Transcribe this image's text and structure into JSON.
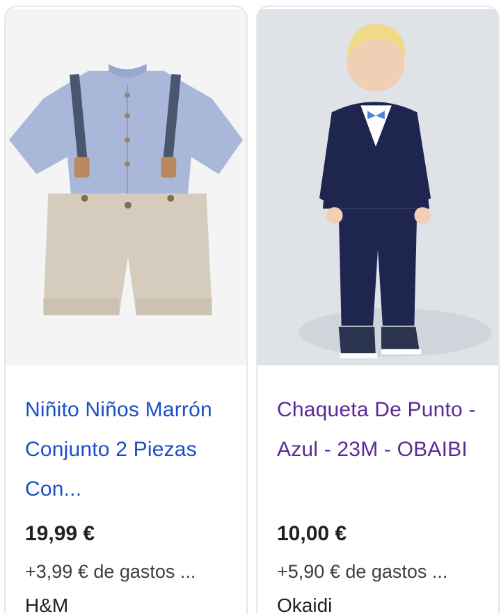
{
  "products": [
    {
      "title": "Niñito Niños Marrón Conjunto 2 Piezas Con...",
      "price": "19,99 €",
      "shipping": "+3,99 € de gastos ...",
      "store": "H&M",
      "title_color": "#1a4ec8"
    },
    {
      "title": "Chaqueta De Punto - Azul - 23M - OBAIBI",
      "price": "10,00 €",
      "shipping": "+5,90 € de gastos ...",
      "store": "Okaidi",
      "title_color": "#5a2a9a"
    }
  ]
}
